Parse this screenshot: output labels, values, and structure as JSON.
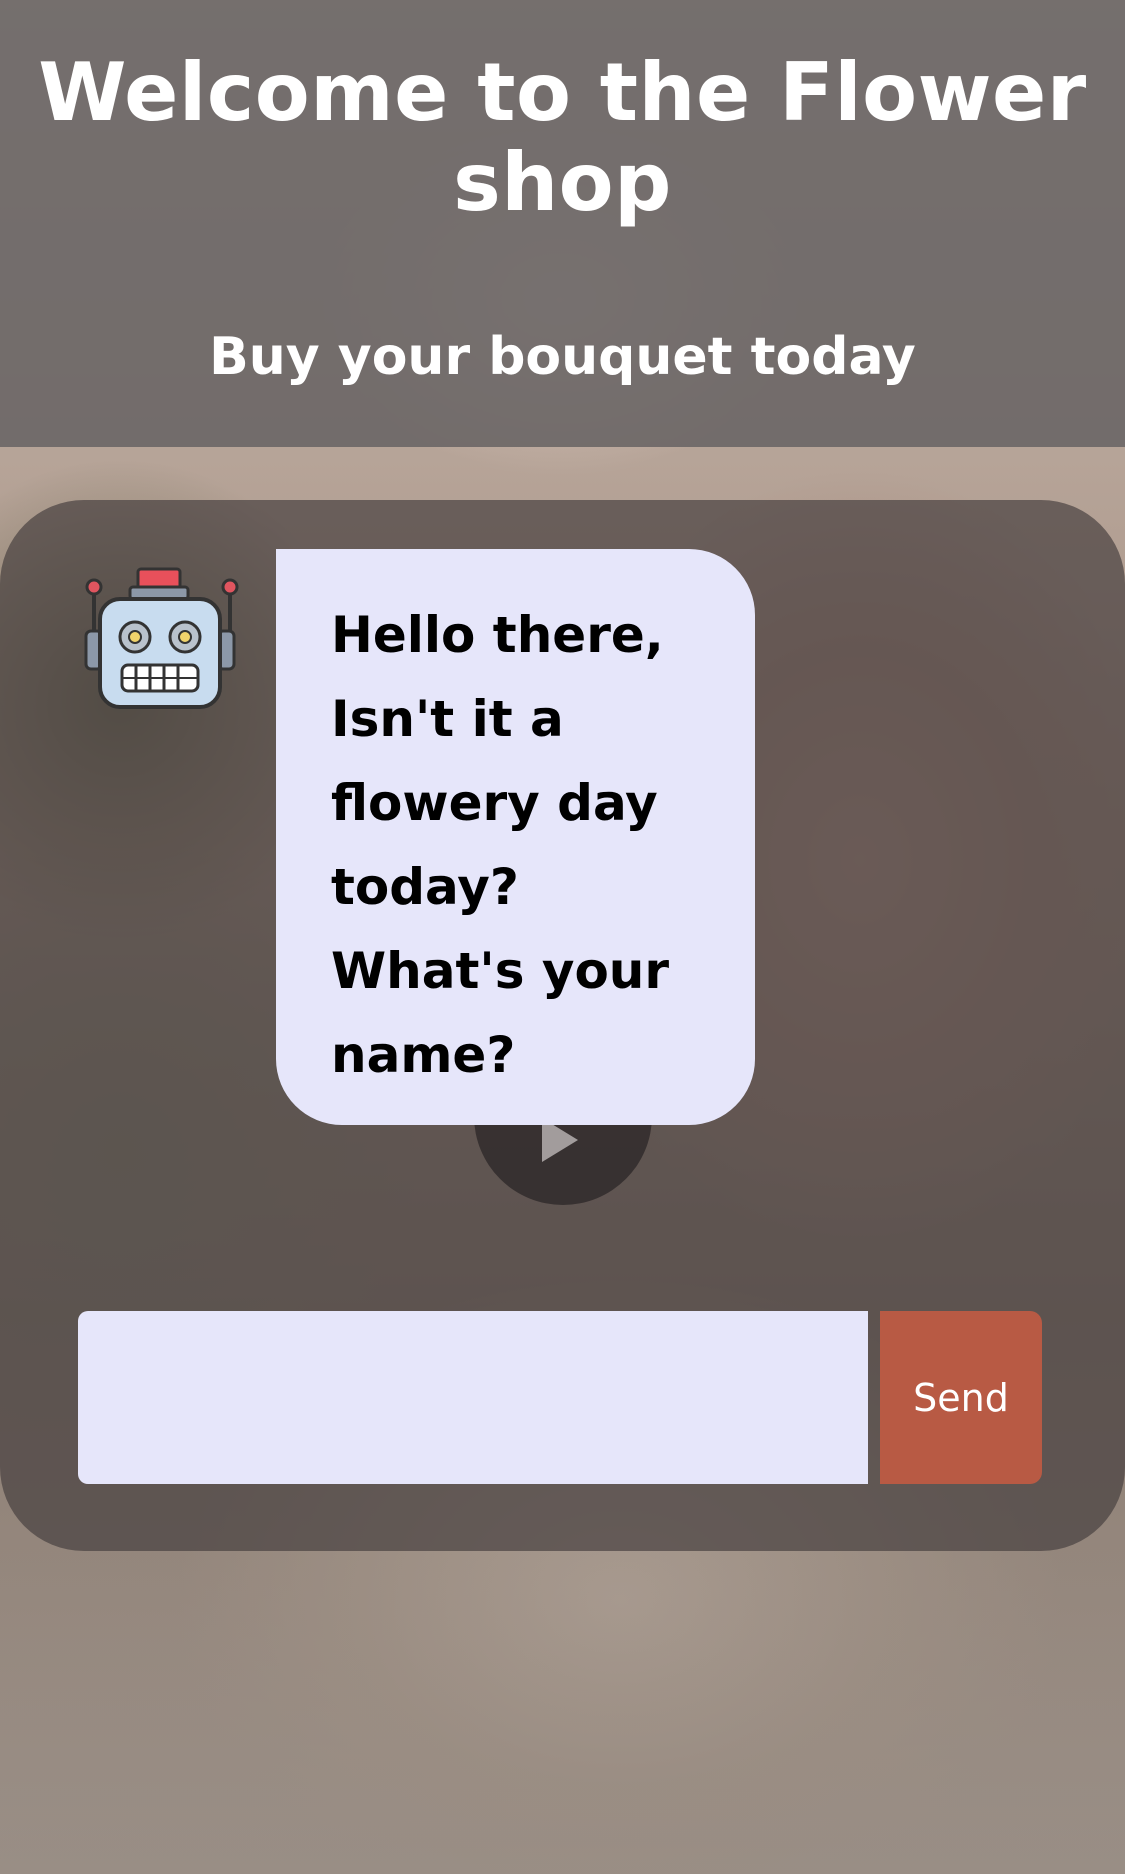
{
  "header": {
    "title": "Welcome to the Flower shop",
    "subtitle": "Buy your bouquet today"
  },
  "chat": {
    "bot_icon": "robot-icon",
    "message": "Hello there, Isn't it a flowery day today? What's your name?",
    "input": {
      "value": "",
      "placeholder": ""
    },
    "send_label": "Send",
    "play_icon": "play-icon"
  },
  "colors": {
    "bubble_bg": "#e6e6fa",
    "send_button": "#b85a44",
    "header_overlay": "#69646480"
  }
}
